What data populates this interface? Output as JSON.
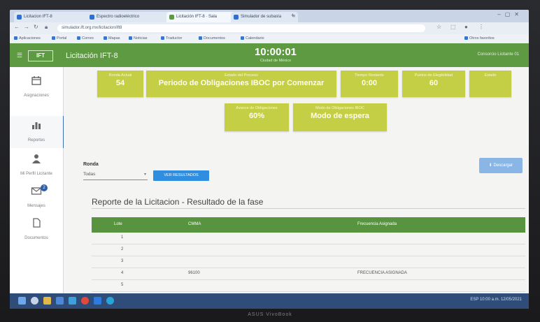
{
  "browser": {
    "tabs": [
      {
        "label": "Licitacion IFT-8"
      },
      {
        "label": "Espectro radioeléctrico"
      },
      {
        "label": "Licitación IFT-8 · Sala"
      },
      {
        "label": "Simulador de subasta"
      }
    ],
    "url": "simulador.ift.org.mx/licitacion/ift8"
  },
  "bookmarks": [
    "Aplicaciones",
    "Portal",
    "Correo",
    "Mapas",
    "Noticias",
    "Traductor",
    "Documentos",
    "Calendario",
    "Otros favoritos"
  ],
  "header": {
    "logo_text": "IFT",
    "app_title": "Licitación IFT-8",
    "clock": "10:00:01",
    "clock_sub": "Ciudad de México",
    "user": "Consorcio Licitante 01"
  },
  "sidebar": {
    "items": [
      {
        "label": "Asignaciones"
      },
      {
        "label": "Reportes"
      },
      {
        "label": "Mi Perfil Licitante"
      },
      {
        "label": "Mensajes",
        "badge": "2"
      },
      {
        "label": "Documentos"
      }
    ]
  },
  "cards": {
    "ronda": {
      "label": "Ronda Actual",
      "value": "54"
    },
    "periodo": {
      "label": "Estado del Proceso",
      "value": "Periodo de Obligaciones IBOC por Comenzar"
    },
    "tiempo": {
      "label": "Tiempo Restante",
      "value": "0:00"
    },
    "puntos": {
      "label": "Puntos de Elegibilidad",
      "value": "60"
    },
    "extra": {
      "label": "Estado",
      "value": ""
    },
    "avance": {
      "label": "Avance de Obligaciones",
      "value": "60%"
    },
    "modo": {
      "label": "Modo de Obligaciones IBOC",
      "value": "Modo de espera"
    }
  },
  "filters": {
    "ronda_label": "Ronda",
    "ronda_value": "Todas",
    "show_button": "VER RESULTADOS",
    "right_button": "Descargar"
  },
  "report": {
    "title": "Reporte de la Licitacion - Resultado de la fase",
    "columns": [
      "Lote",
      "CMMA",
      "Frecuencia Asignada"
    ],
    "rows": [
      {
        "lote": "1",
        "cmma": "",
        "freq": ""
      },
      {
        "lote": "2",
        "cmma": "",
        "freq": ""
      },
      {
        "lote": "3",
        "cmma": "",
        "freq": ""
      },
      {
        "lote": "4",
        "cmma": "96100",
        "freq": "FRECUENCIA ASIGNADA"
      },
      {
        "lote": "5",
        "cmma": "",
        "freq": ""
      }
    ]
  },
  "taskbar": {
    "tray": "ESP  10:00 a.m.  12/05/2021"
  },
  "monitor": {
    "brand": "ASUS VivoBook"
  },
  "colors": {
    "header_green": "#5d9a41",
    "card_lime": "#c5cf45",
    "table_green": "#58933f",
    "button_blue": "#2f8ee0"
  }
}
